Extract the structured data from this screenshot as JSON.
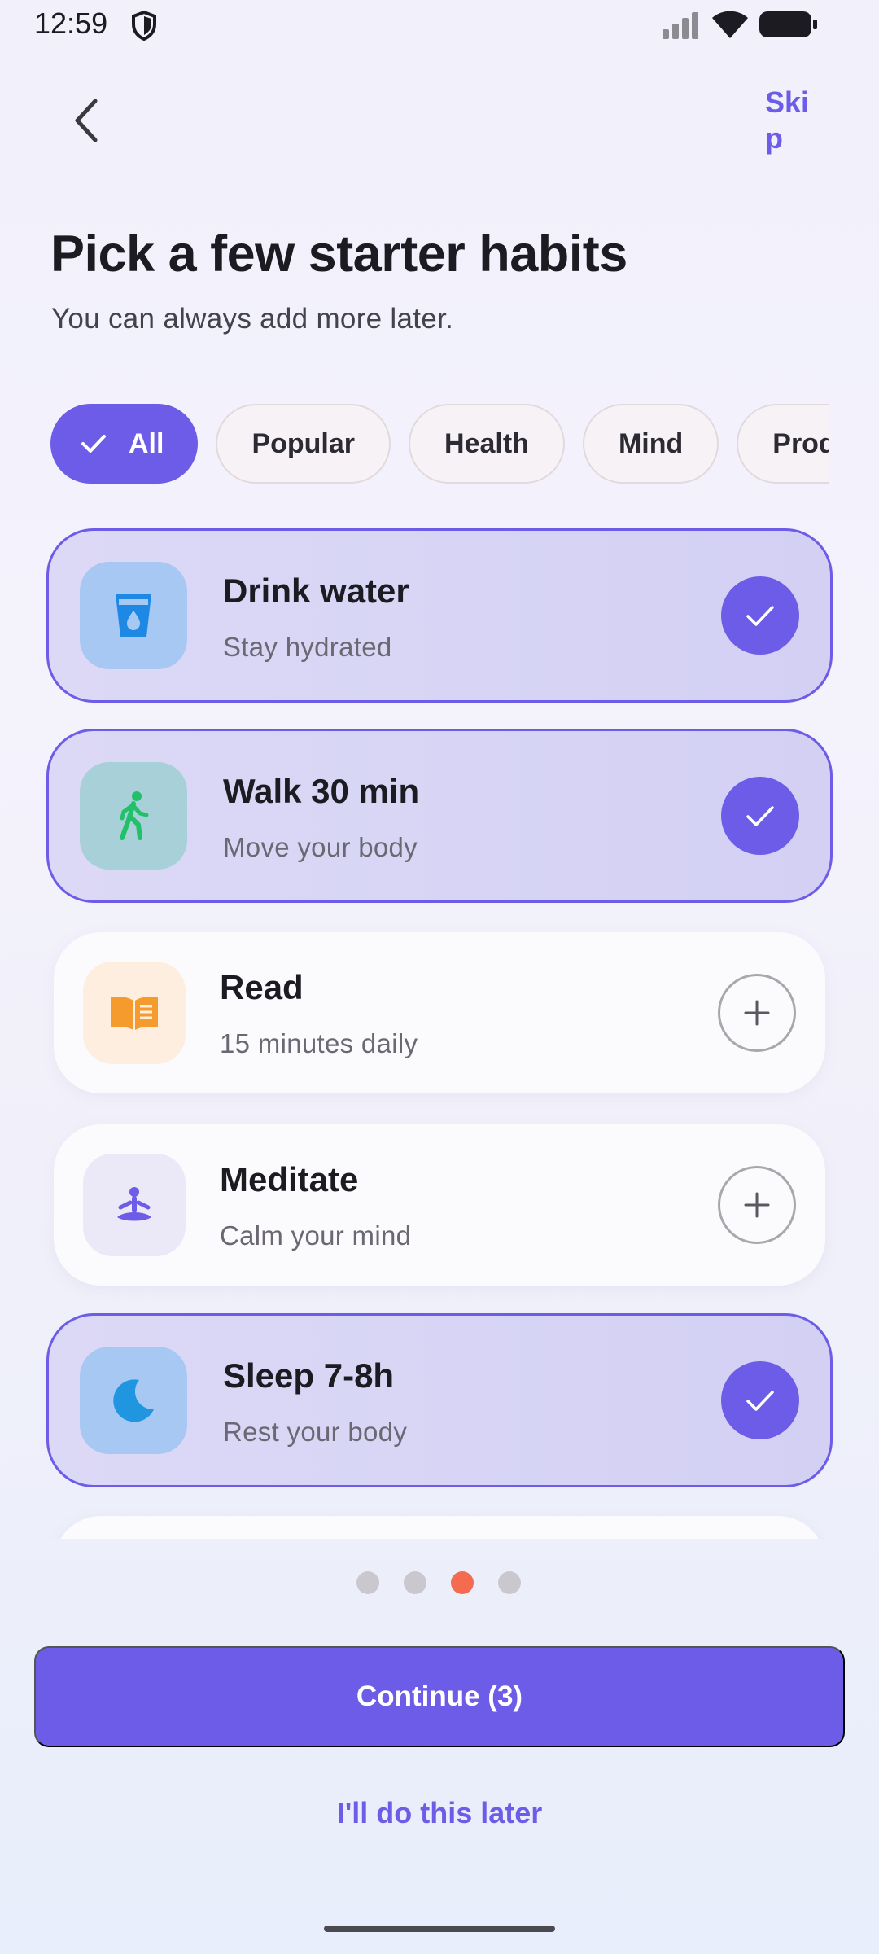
{
  "status_bar": {
    "time": "12:59",
    "icons": [
      "shield-icon",
      "signal-icon",
      "wifi-icon",
      "battery-icon"
    ]
  },
  "top_bar": {
    "back_icon": "chevron-left-icon",
    "skip_label": "Skip"
  },
  "header": {
    "title": "Pick a few starter habits",
    "subtitle": "You can always add more later."
  },
  "filters": {
    "chips": [
      {
        "label": "All",
        "active": true
      },
      {
        "label": "Popular",
        "active": false
      },
      {
        "label": "Health",
        "active": false
      },
      {
        "label": "Mind",
        "active": false
      },
      {
        "label": "Productivity",
        "active": false
      }
    ]
  },
  "habits": [
    {
      "name": "Drink water",
      "description": "Stay hydrated",
      "icon": "water-glass-icon",
      "selected": true,
      "tile_color": "#a8c8f4",
      "icon_color": "#1e88e5"
    },
    {
      "name": "Walk 30 min",
      "description": "Move your body",
      "icon": "walking-icon",
      "selected": true,
      "tile_color": "#a8d0d8",
      "icon_color": "#23c06a"
    },
    {
      "name": "Read",
      "description": "15 minutes daily",
      "icon": "book-icon",
      "selected": false,
      "tile_color": "#fdeee0",
      "icon_color": "#f59a2c"
    },
    {
      "name": "Meditate",
      "description": "Calm your mind",
      "icon": "meditation-icon",
      "selected": false,
      "tile_color": "#ebe8f7",
      "icon_color": "#6c5ce7"
    },
    {
      "name": "Sleep 7-8h",
      "description": "Rest your body",
      "icon": "moon-icon",
      "selected": true,
      "tile_color": "#a8c8f4",
      "icon_color": "#2196e0"
    }
  ],
  "pagination": {
    "total": 4,
    "current": 3
  },
  "actions": {
    "continue_label": "Continue (3)",
    "later_label": "I'll do this later"
  },
  "colors": {
    "accent": "#6c5ce7",
    "pager_active": "#f46b4f"
  }
}
